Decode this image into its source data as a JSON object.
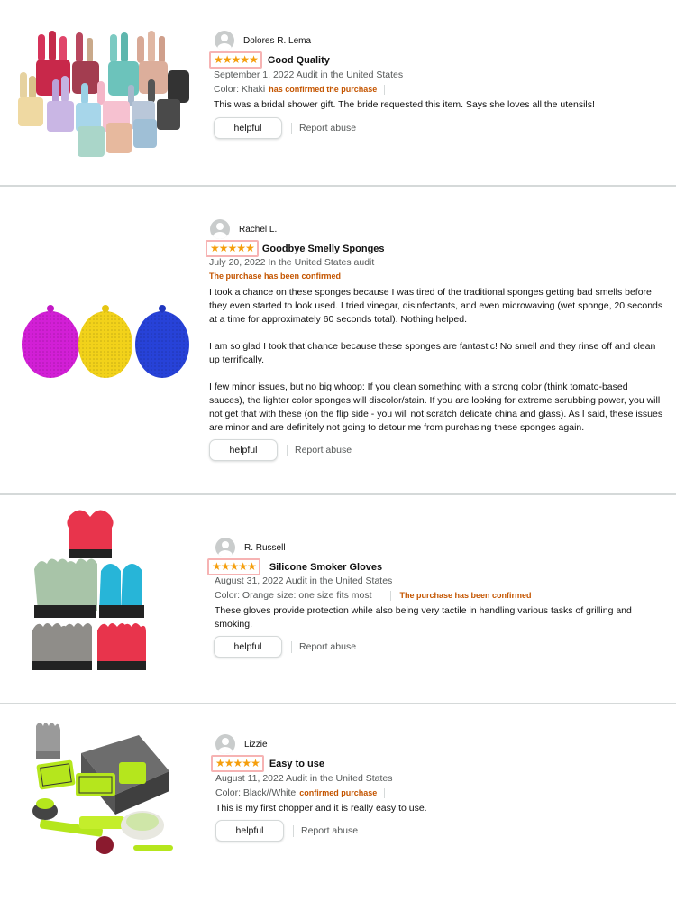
{
  "reviews": [
    {
      "author": "Dolores R. Lema",
      "title": "Good Quality",
      "rating": 5,
      "date_location": "September 1, 2022 Audit in the United States",
      "variant": "Color: Khaki",
      "verified": "has confirmed the purchase",
      "body": [
        "This was a bridal shower gift. The bride requested this item. Says she loves all the utensils!"
      ],
      "helpful_label": "helpful",
      "report_label": "Report abuse",
      "image": "kitchen-utensil-set-image"
    },
    {
      "author": "Rachel L.",
      "title": "Goodbye Smelly Sponges",
      "rating": 5,
      "date_location": "July 20, 2022 In the United States audit",
      "verified": "The purchase has been confirmed",
      "body": [
        "I took a chance on these sponges because I was tired of the traditional sponges getting bad smells before they even started to look used. I tried vinegar, disinfectants, and even microwaving (wet sponge, 20 seconds at a time for approximately 60 seconds total). Nothing helped.",
        "I am so glad I took that chance because these sponges are fantastic! No smell and they rinse off and clean up terrifically.",
        "I few minor issues, but no big whoop: If you clean something with a strong color (think tomato-based sauces), the lighter color sponges will discolor/stain. If you are looking for extreme scrubbing power, you will not get that with these (on the flip side - you will not scratch delicate china and glass). As I said, these issues are minor and are definitely not going to detour me from purchasing these sponges again."
      ],
      "helpful_label": "helpful",
      "report_label": "Report abuse",
      "image": "silicone-sponges-image"
    },
    {
      "author": "R. Russell",
      "title": "Silicone Smoker Gloves",
      "rating": 5,
      "date_location": "August 31, 2022 Audit in the United States",
      "variant": "Color: Orange size: one size fits most",
      "verified": "The purchase has been confirmed",
      "body": [
        "These gloves provide protection while also being very tactile in handling various tasks of grilling and smoking."
      ],
      "helpful_label": "helpful",
      "report_label": "Report abuse",
      "image": "silicone-gloves-image"
    },
    {
      "author": "Lizzie",
      "title": "Easy to use",
      "rating": 5,
      "date_location": "August 11, 2022 Audit in the United States",
      "variant": "Color: Black//White",
      "verified": "confirmed purchase",
      "body": [
        "This is my first chopper and it is really easy to use."
      ],
      "helpful_label": "helpful",
      "report_label": "Report abuse",
      "image": "vegetable-chopper-image"
    }
  ],
  "colors": {
    "star": "#f59e0b",
    "star_highlight_border": "#f6b3b3",
    "verified": "#c45500",
    "meta": "#565959",
    "divider": "#d5d9d9"
  }
}
